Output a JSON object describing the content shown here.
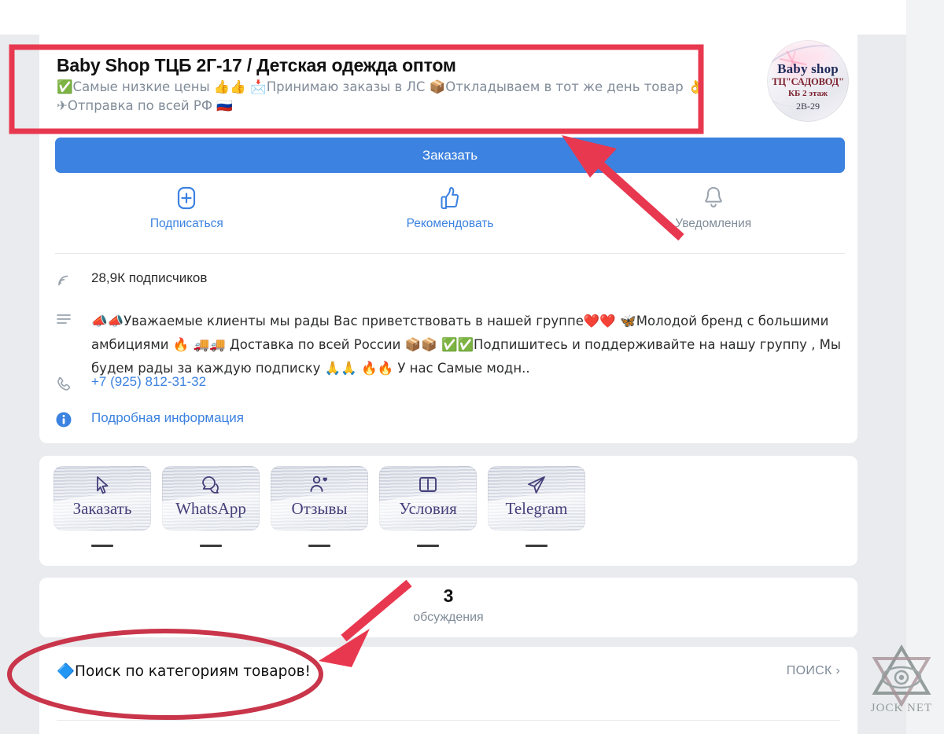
{
  "colors": {
    "accent": "#3c82e0",
    "page_bg": "#e9ebee",
    "card_bg": "#ffffff",
    "muted_text": "#818c99",
    "annotation_red": "#e8384f",
    "menu_label": "#453f7a"
  },
  "profile": {
    "title": "Baby Shop ТЦБ 2Г-17 / Детская одежда оптом",
    "subtitle_line1": "✅Самые низкие цены 👍👍 📩Принимаю заказы в ЛС 📦Откладываем в тот же день товар 👌",
    "subtitle_line2": "✈Отправка по всей РФ 🇷🇺",
    "avatar": {
      "line1": "Baby shop",
      "line2": "ТЦ\"САДОВОД\"",
      "line3": "КБ 2 этаж",
      "line4": "2В-29"
    },
    "primary_button": "Заказать",
    "actions": [
      {
        "label": "Подписаться",
        "icon": "plus-box-icon",
        "muted": false
      },
      {
        "label": "Рекомендовать",
        "icon": "thumbs-up-icon",
        "muted": false
      },
      {
        "label": "Уведомления",
        "icon": "bell-icon",
        "muted": true
      }
    ],
    "subscribers": "28,9К подписчиков",
    "description": "📣📣Уважаемые клиенты мы  рады Вас приветствовать в нашей группе❤️❤️ 🦋Молодой бренд с большими амбициями 🔥   🚚🚚 Доставка по всей России 📦📦 ✅✅Подпишитесь  и поддерживайте на нашу группу , Мы будем рады за каждую подписку 🙏🙏 🔥🔥 У нас Самые модн..",
    "phone": "+7 (925) 812-31-32",
    "details_link": "Подробная информация"
  },
  "menu": {
    "items": [
      {
        "label": "Заказать",
        "icon": "cursor-icon"
      },
      {
        "label": "WhatsApp",
        "icon": "chat-bubble-icon"
      },
      {
        "label": "Отзывы",
        "icon": "person-heart-icon"
      },
      {
        "label": "Условия",
        "icon": "book-icon"
      },
      {
        "label": "Telegram",
        "icon": "paper-plane-icon"
      }
    ]
  },
  "discussions": {
    "count": "3",
    "caption": "обсуждения"
  },
  "search": {
    "title": "🔷Поиск по категориям товаров!",
    "action_label": "ПОИСК",
    "action_chevron": "›"
  },
  "annotations": {
    "header_box": "red-rectangle-around-group-title",
    "arrow_to_order_button": "red-arrow-pointing-to-order-button",
    "arrow_to_search_row": "red-arrow-pointing-to-search-row",
    "ellipse_around_search": "red-ellipse-around-search-title"
  },
  "watermark": {
    "text": "JOCK NET",
    "icon": "eye-in-triangle-icon"
  }
}
